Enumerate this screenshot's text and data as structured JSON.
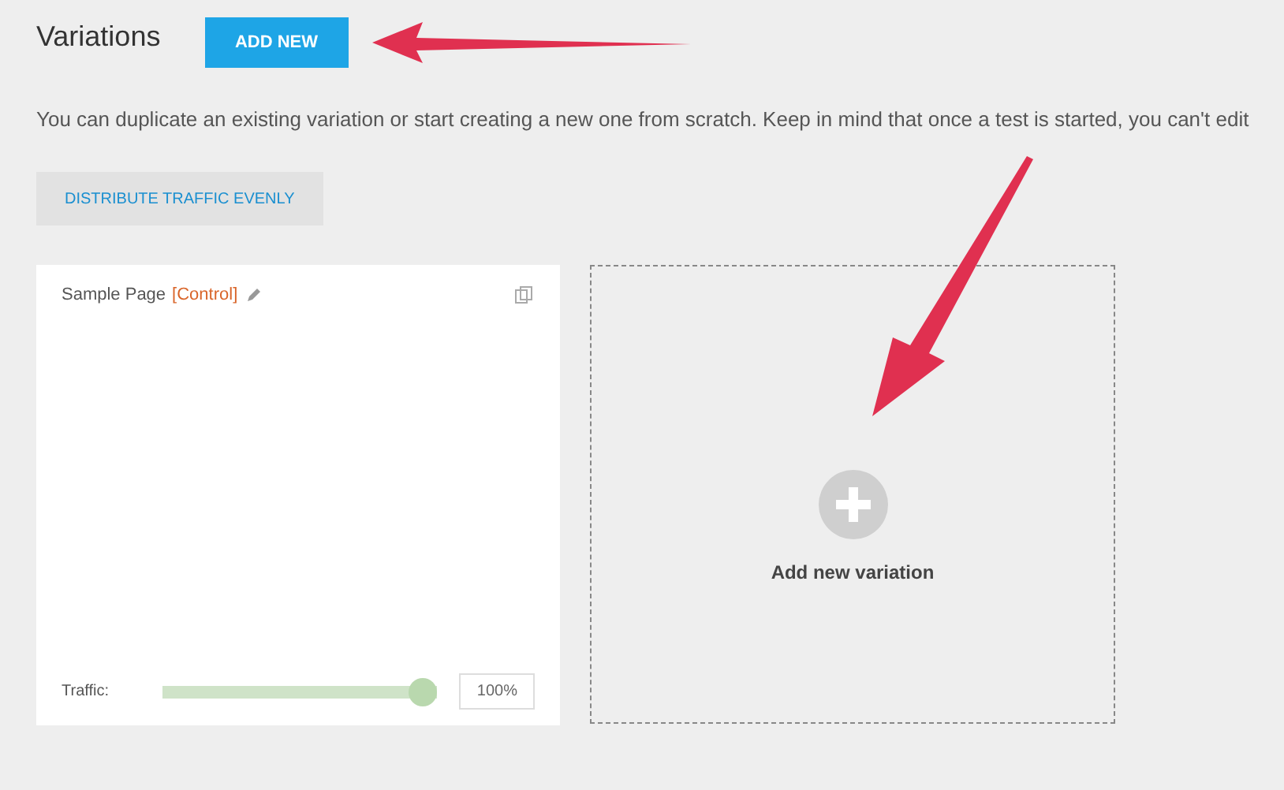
{
  "header": {
    "title": "Variations",
    "add_button": "ADD NEW"
  },
  "description": "You can duplicate an existing variation or start creating a new one from scratch. Keep in mind that once a test is started, you can't edit",
  "distribute_button": "DISTRIBUTE TRAFFIC EVENLY",
  "variations": [
    {
      "name": "Sample Page",
      "tag": "[Control]",
      "traffic_label": "Traffic:",
      "level": 1,
      "traffic_value": "100%"
    }
  ],
  "add_variation": {
    "label": "Add new variation"
  }
}
